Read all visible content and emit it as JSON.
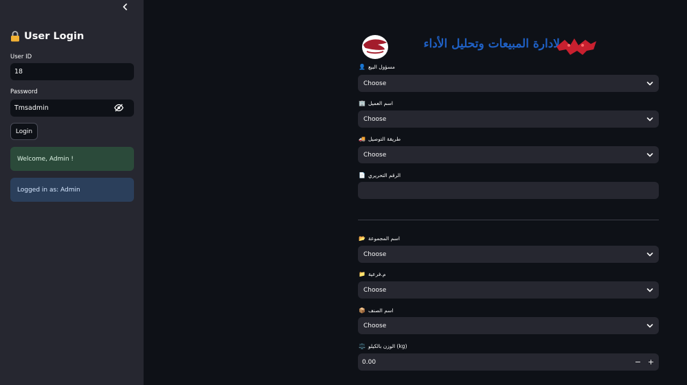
{
  "sidebar": {
    "title": "User Login",
    "title_icon": "lock-icon",
    "user_id_label": "User ID",
    "user_id_value": "18",
    "password_label": "Password",
    "password_value": "Tmsadmin",
    "login_button": "Login",
    "success_message": "Welcome, Admin !",
    "info_message": "Logged in as: Admin"
  },
  "header": {
    "title": "لادارة المبيعات وتحليل الأداء"
  },
  "form": {
    "sales_rep": {
      "label": "مسؤول البيع",
      "emoji": "👤",
      "value": "Choose"
    },
    "customer": {
      "label": "اسم العميل",
      "emoji": "🏢",
      "value": "Choose"
    },
    "delivery": {
      "label": "طريقة التوصيل",
      "emoji": "🚚",
      "value": "Choose"
    },
    "serial": {
      "label": "الرقم التحريري",
      "emoji": "📄",
      "value": ""
    },
    "group": {
      "label": "اسم المجموعة",
      "emoji": "📂",
      "value": "Choose"
    },
    "subgroup": {
      "label": "م.فرعية",
      "emoji": "📁",
      "value": "Choose"
    },
    "item": {
      "label": "اسم الصنف",
      "emoji": "📦",
      "value": "Choose"
    },
    "weight": {
      "label": "الوزن بالكيلو (kg)",
      "emoji": "⚖️",
      "value": "0.00",
      "minus": "−",
      "plus": "+"
    }
  },
  "colors": {
    "sidebar_bg": "#262730",
    "main_bg": "#0e1117",
    "title_blue": "#1f60c4",
    "success_bg": "#2b4a3a",
    "info_bg": "#2b3f5b"
  }
}
